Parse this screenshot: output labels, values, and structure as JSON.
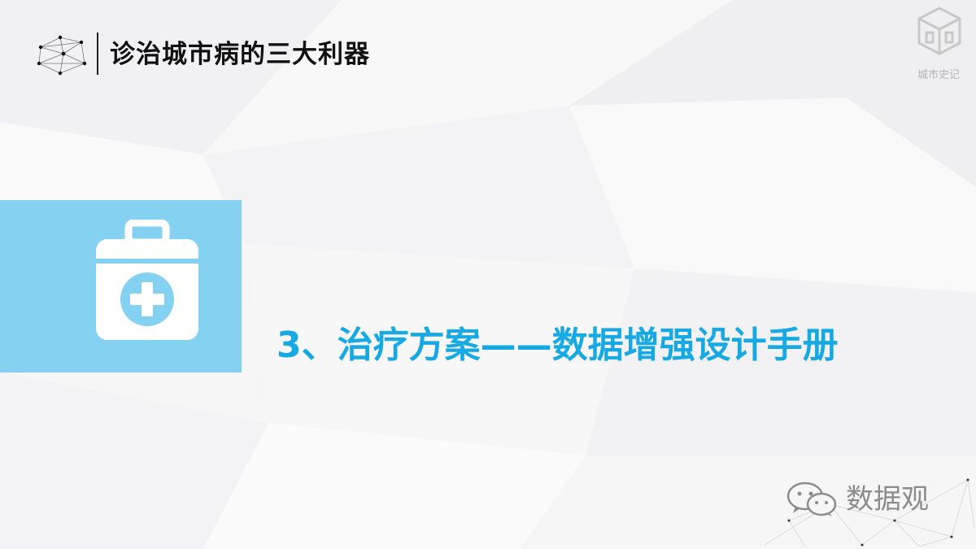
{
  "header": {
    "title": "诊治城市病的三大利器"
  },
  "brand": {
    "name": "城市史记"
  },
  "section": {
    "heading": "3、治疗方案——数据增强设计手册",
    "icon": "medical-kit-icon"
  },
  "watermark": {
    "icon": "wechat-icon",
    "text": "数据观"
  },
  "colors": {
    "accent": "#16a9e3",
    "panel": "#85d1f1",
    "title": "#111111"
  }
}
